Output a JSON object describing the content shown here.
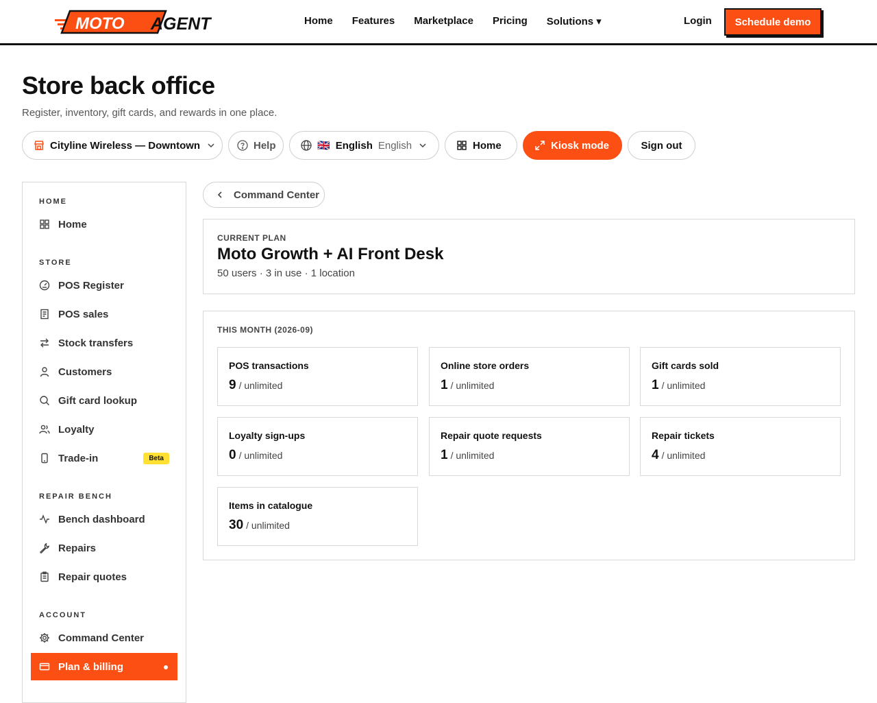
{
  "brand": {
    "moto": "MOTO",
    "agent": "AGENT",
    "accent": "#fb4f14"
  },
  "nav": {
    "links": [
      "Home",
      "Features",
      "Marketplace",
      "Pricing",
      "Solutions ▾"
    ],
    "login": "Login",
    "cta": "Schedule demo"
  },
  "header": {
    "title": "Store back office",
    "subtitle": "Register, inventory, gift cards, and rewards in one place."
  },
  "controls": {
    "store": "Cityline Wireless — Downtown",
    "help": "Help",
    "lang_flag": "🇬🇧",
    "lang_native": "English",
    "lang_english": "English",
    "home": "Home",
    "kiosk": "Kiosk mode",
    "signout": "Sign out"
  },
  "sidebar": {
    "sections": {
      "home": "HOME",
      "store": "STORE",
      "repair": "REPAIR BENCH",
      "account": "ACCOUNT"
    },
    "items": [
      {
        "label": "Home",
        "icon": "grid-icon"
      },
      {
        "label": "POS Register",
        "icon": "gauge-icon"
      },
      {
        "label": "POS sales",
        "icon": "receipt-icon"
      },
      {
        "label": "Stock transfers",
        "icon": "arrows-swap-icon"
      },
      {
        "label": "Customers",
        "icon": "user-icon"
      },
      {
        "label": "Gift card lookup",
        "icon": "search-icon"
      },
      {
        "label": "Loyalty",
        "icon": "users-icon"
      },
      {
        "label": "Trade-in",
        "icon": "phone-icon",
        "badge": "Beta"
      },
      {
        "label": "Bench dashboard",
        "icon": "pulse-icon"
      },
      {
        "label": "Repairs",
        "icon": "wrench-icon"
      },
      {
        "label": "Repair quotes",
        "icon": "clipboard-icon"
      },
      {
        "label": "Command Center",
        "icon": "gear-icon"
      },
      {
        "label": "Plan & billing",
        "icon": "card-icon",
        "active": true
      }
    ]
  },
  "breadcrumb": {
    "back_label": "Command Center"
  },
  "plan": {
    "label": "CURRENT PLAN",
    "name": "Moto Growth + AI Front Desk",
    "meta": "50 users · 3 in use · 1 location"
  },
  "month": {
    "label": "THIS MONTH (2026-09)",
    "stats": [
      {
        "title": "POS transactions",
        "value": "9",
        "limit": "/ unlimited"
      },
      {
        "title": "Online store orders",
        "value": "1",
        "limit": "/ unlimited"
      },
      {
        "title": "Gift cards sold",
        "value": "1",
        "limit": "/ unlimited"
      },
      {
        "title": "Loyalty sign-ups",
        "value": "0",
        "limit": "/ unlimited"
      },
      {
        "title": "Repair quote requests",
        "value": "1",
        "limit": "/ unlimited"
      },
      {
        "title": "Repair tickets",
        "value": "4",
        "limit": "/ unlimited"
      },
      {
        "title": "Items in catalogue",
        "value": "30",
        "limit": "/ unlimited"
      }
    ]
  }
}
